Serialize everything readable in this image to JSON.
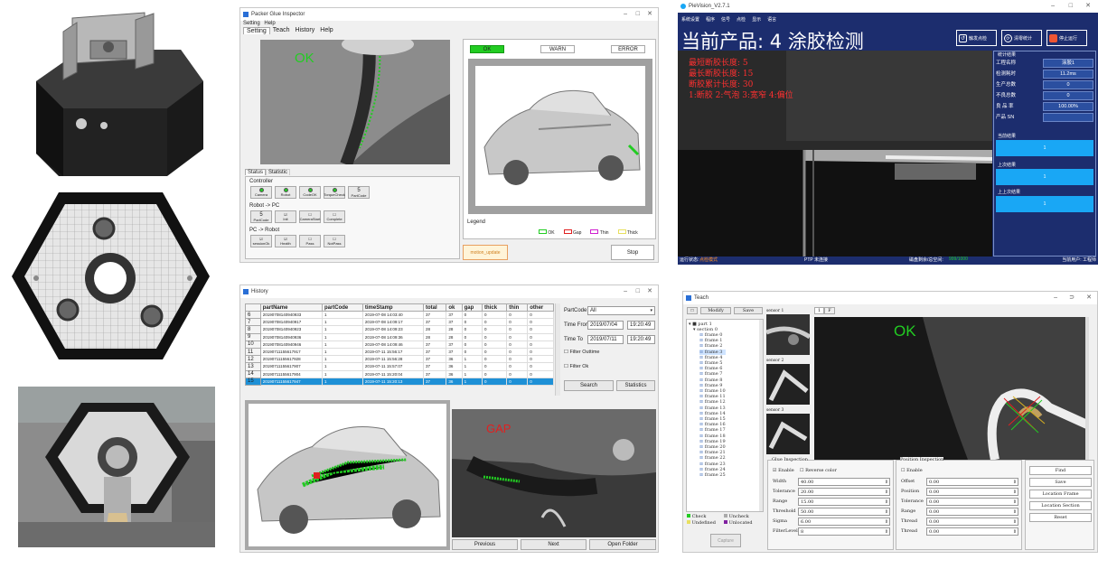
{
  "colors": {
    "ok_green": "#22cc22",
    "selected_blue": "#1e90d6",
    "pv_bg": "#1c2d6e",
    "pv_cyan": "#19a7f5",
    "overlay_red": "#e02020"
  },
  "photos": {
    "top_alt": "",
    "mid_alt": "",
    "bottom_alt": ""
  },
  "inspector": {
    "title": "Packer Glue Inspector",
    "menu": [
      "Setting",
      "Help"
    ],
    "tabs": [
      "Setting",
      "Teach",
      "History",
      "Help"
    ],
    "cam_overlay": "OK",
    "status_buttons": [
      {
        "label": "OK",
        "active": true
      },
      {
        "label": "WARN",
        "active": false
      },
      {
        "label": "ERROR",
        "active": false
      }
    ],
    "status_tabs": [
      "Status",
      "Statistic"
    ],
    "controller_label": "Controller",
    "controller": [
      {
        "label": "Camera",
        "led": "on"
      },
      {
        "label": "Robot",
        "led": "on"
      },
      {
        "label": "CodeOK",
        "led": "on"
      },
      {
        "label": "TorqueCheck",
        "led": "on"
      },
      {
        "label": "PartCode",
        "value": "5"
      }
    ],
    "robot_pc_label": "Robot -> PC",
    "robot_pc": [
      {
        "label": "PartCode",
        "value": "5"
      },
      {
        "label": "Init",
        "check": "☑"
      },
      {
        "label": "CameraStart",
        "check": "☐"
      },
      {
        "label": "Complete",
        "check": "☐"
      }
    ],
    "pc_robot_label": "PC -> Robot",
    "pc_robot": [
      {
        "label": "sessionOk",
        "check": "☑"
      },
      {
        "label": "Health",
        "check": "☑"
      },
      {
        "label": "Pass",
        "check": "☐"
      },
      {
        "label": "NotPass",
        "check": "☐"
      }
    ],
    "legend_label": "Legend",
    "legend": [
      {
        "label": "OK",
        "color": "#22cc22"
      },
      {
        "label": "Gap",
        "color": "#e02020"
      },
      {
        "label": "Thin",
        "color": "#d020d0"
      },
      {
        "label": "Thick",
        "color": "#e8e060"
      }
    ],
    "message_label": "motion_update",
    "stop_label": "Stop"
  },
  "pievision": {
    "title": "PieVision_V2.7.1",
    "menu": [
      "系统设置",
      "程序",
      "信号",
      "点检",
      "显示",
      "语言"
    ],
    "product_title": "当前产品: 4 涂胶检测",
    "buttons": [
      {
        "label": "触发点检",
        "icon": "trigger-icon"
      },
      {
        "label": "清零统计",
        "icon": "reset-icon"
      },
      {
        "label": "停止运行",
        "icon": "stop-icon"
      }
    ],
    "overlay_lines": [
      "最短断胶长度: 5",
      "最长断胶长度: 15",
      "断胶累计长度: 30",
      "1:断胶  2:气泡  3:宽窄  4:偏位"
    ],
    "stats_header": "统计结果",
    "stats": [
      {
        "k": "工程名称",
        "v": "涂胶1"
      },
      {
        "k": "检测耗时",
        "v": "11.2ms"
      },
      {
        "k": "生产总数",
        "v": "0"
      },
      {
        "k": "不良总数",
        "v": "0"
      },
      {
        "k": "良  品  率",
        "v": "100.00%"
      },
      {
        "k": "产品 SN",
        "v": ""
      }
    ],
    "result_sections": [
      {
        "label": "当前结果",
        "value": "1"
      },
      {
        "label": "上次结果",
        "value": "1"
      },
      {
        "label": "上上次结果",
        "value": "1"
      }
    ],
    "status_left_label": "运行状态:",
    "status_left_value": "点检模式",
    "status_mid": "PTP 未连接",
    "status_right_label": "磁盘剩余/总空间:",
    "status_right_value": "999/1000",
    "status_user": "当前用户: 工程师"
  },
  "history": {
    "title": "History",
    "columns": [
      "",
      "partName",
      "partCode",
      "timeStamp",
      "total",
      "ok",
      "gap",
      "thick",
      "thin",
      "other"
    ],
    "rows": [
      {
        "n": "6",
        "part": "20190708140940933",
        "code": "1",
        "ts": "2019-07-08 14:03:40",
        "total": "37",
        "ok": "37",
        "gap": "0",
        "thick": "0",
        "thin": "0",
        "other": "0",
        "sel": false
      },
      {
        "n": "7",
        "part": "20190708140940917",
        "code": "1",
        "ts": "2019-07-08 14:09:17",
        "total": "37",
        "ok": "37",
        "gap": "0",
        "thick": "0",
        "thin": "0",
        "other": "0",
        "sel": false
      },
      {
        "n": "8",
        "part": "20190708140940923",
        "code": "1",
        "ts": "2019-07-08 14:09:23",
        "total": "28",
        "ok": "28",
        "gap": "0",
        "thick": "0",
        "thin": "0",
        "other": "0",
        "sel": false
      },
      {
        "n": "9",
        "part": "20190708140940936",
        "code": "1",
        "ts": "2019-07-08 14:09:36",
        "total": "28",
        "ok": "28",
        "gap": "0",
        "thick": "0",
        "thin": "0",
        "other": "0",
        "sel": false
      },
      {
        "n": "10",
        "part": "20190708140940946",
        "code": "1",
        "ts": "2019-07-08 14:09:46",
        "total": "37",
        "ok": "37",
        "gap": "0",
        "thick": "0",
        "thin": "0",
        "other": "0",
        "sel": false
      },
      {
        "n": "11",
        "part": "20190711155617917",
        "code": "1",
        "ts": "2019-07-11 15:56:17",
        "total": "37",
        "ok": "37",
        "gap": "0",
        "thick": "0",
        "thin": "0",
        "other": "0",
        "sel": false
      },
      {
        "n": "12",
        "part": "20190711155617928",
        "code": "1",
        "ts": "2019-07-11 15:56:28",
        "total": "37",
        "ok": "36",
        "gap": "1",
        "thick": "0",
        "thin": "0",
        "other": "0",
        "sel": false
      },
      {
        "n": "13",
        "part": "20190711155617907",
        "code": "1",
        "ts": "2019-07-11 15:57:07",
        "total": "37",
        "ok": "36",
        "gap": "1",
        "thick": "0",
        "thin": "0",
        "other": "0",
        "sel": false
      },
      {
        "n": "14",
        "part": "20190711155617904",
        "code": "1",
        "ts": "2019-07-11 15:20:04",
        "total": "37",
        "ok": "36",
        "gap": "1",
        "thick": "0",
        "thin": "0",
        "other": "0",
        "sel": false
      },
      {
        "n": "15",
        "part": "20190711155617947",
        "code": "1",
        "ts": "2019-07-11 15:20:13",
        "total": "37",
        "ok": "36",
        "gap": "1",
        "thick": "0",
        "thin": "0",
        "other": "0",
        "sel": true
      }
    ],
    "partcode_label": "PartCode",
    "partcode_value": "All",
    "time_from_label": "Time From",
    "time_from_date": "2019/07/04",
    "time_from_time": "19:20:49",
    "time_to_label": "Time To",
    "time_to_date": "2019/07/11",
    "time_to_time": "19:20:49",
    "filter_outtime": "Filter Outtime",
    "filter_ok": "Filter Ok",
    "search_label": "Search",
    "statistics_label": "Statistics",
    "cam_overlay": "GAP",
    "previous_label": "Previous",
    "next_label": "Next",
    "open_folder_label": "Open Folder"
  },
  "teach": {
    "title": "Teach",
    "top_buttons": [
      "Modify",
      "Save"
    ],
    "tree_root": "part 1",
    "tree_section": "section 0",
    "frames": [
      "frame 0",
      "frame 1",
      "frame 2",
      "frame 3",
      "frame 4",
      "frame 5",
      "frame 6",
      "frame 7",
      "frame 8",
      "frame 9",
      "frame 10",
      "frame 11",
      "frame 12",
      "frame 13",
      "frame 14",
      "frame 15",
      "frame 16",
      "frame 17",
      "frame 18",
      "frame 19",
      "frame 20",
      "frame 21",
      "frame 22",
      "frame 23",
      "frame 24",
      "frame 25"
    ],
    "selected_frame": 3,
    "legend": [
      {
        "label": "Check",
        "color": "#22cc22"
      },
      {
        "label": "Uncheck",
        "color": "#aaaaaa"
      },
      {
        "label": "Undefined",
        "color": "#e8e060"
      },
      {
        "label": "Unlocated",
        "color": "#8020a0"
      }
    ],
    "capture_label": "Capture",
    "sensors": [
      "sensor 1",
      "sensor 2",
      "sensor 3"
    ],
    "view_tabs": [
      "1",
      "F"
    ],
    "cam_overlay": "OK",
    "glue": {
      "title": "Glue Inspection",
      "enable": "Enable",
      "reverse": "Reverse color",
      "fields": [
        {
          "k": "Width",
          "v": "40.00"
        },
        {
          "k": "Tolerance",
          "v": "20.00"
        },
        {
          "k": "Range",
          "v": "15.00"
        },
        {
          "k": "Threshold",
          "v": "50.00"
        },
        {
          "k": "Sigma",
          "v": "6.00"
        },
        {
          "k": "FilterLevel",
          "v": "8"
        }
      ]
    },
    "position": {
      "title": "Position Inspection",
      "enable": "Enable",
      "fields": [
        {
          "k": "Offset",
          "v": "0.00"
        },
        {
          "k": "Position",
          "v": "0.00"
        },
        {
          "k": "Tolerance",
          "v": "0.00"
        },
        {
          "k": "Range",
          "v": "0.00"
        },
        {
          "k": "Thread",
          "v": "0.00"
        },
        {
          "k": "Thread",
          "v": "0.00"
        }
      ]
    },
    "right_buttons": [
      "Find",
      "Save",
      "Location  Frame",
      "Location  Section",
      "Reset"
    ]
  }
}
